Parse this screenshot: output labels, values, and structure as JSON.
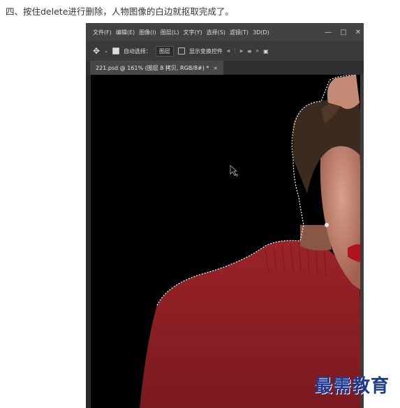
{
  "caption": "四、按住delete进行删除，人物图像的白边就抠取完成了。",
  "menubar": {
    "items": [
      "文件(F)",
      "编辑(E)",
      "图像(I)",
      "图层(L)",
      "文字(Y)",
      "选择(S)",
      "滤镜(T)",
      "3D(D)"
    ],
    "min_label": "—",
    "restore_label": "□",
    "close_label": "✕"
  },
  "optbar": {
    "auto_select_label": "自动选择：",
    "auto_select_checked": true,
    "layer_select_value": "图层",
    "show_transform_label": "显示变换控件",
    "show_transform_checked": false
  },
  "document_tab": {
    "title": "221.psd @ 161% (图层 8 拷贝, RGB/8#) *",
    "close_label": "×"
  },
  "watermark": "最需教育",
  "colors": {
    "canvas": "#000000",
    "sweater": "#8e1f24",
    "app_bg": "#535353"
  }
}
